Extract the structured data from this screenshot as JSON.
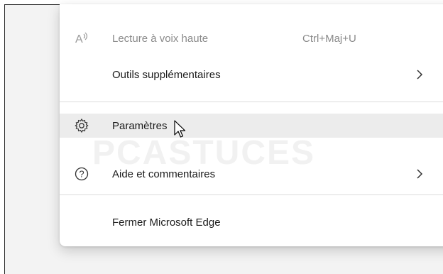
{
  "menu": {
    "items": [
      {
        "label": "Lecture à voix haute",
        "shortcut": "Ctrl+Maj+U",
        "icon": "read-aloud-icon"
      },
      {
        "label": "Outils supplémentaires",
        "icon": "chevron-right-icon"
      },
      {
        "label": "Paramètres",
        "icon": "gear-icon"
      },
      {
        "label": "Aide et commentaires",
        "icon": "help-icon"
      },
      {
        "label": "Fermer Microsoft Edge"
      }
    ]
  },
  "watermark": {
    "text": "PCASTUCES"
  },
  "colors": {
    "hover": "#ececec",
    "divider": "#dcdcdc",
    "disabled_text": "#8a8a8a"
  }
}
